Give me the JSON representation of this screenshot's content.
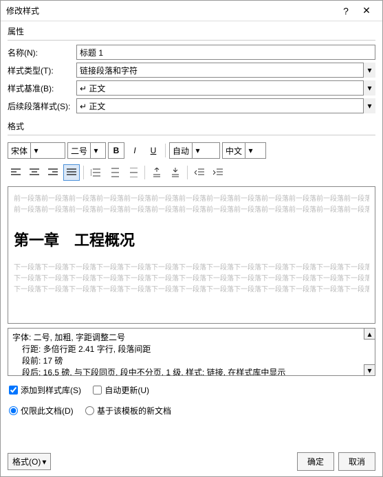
{
  "dialog": {
    "title": "修改样式"
  },
  "sections": {
    "properties": "属性",
    "format": "格式"
  },
  "labels": {
    "name": "名称(N):",
    "style_type": "样式类型(T):",
    "style_base": "样式基准(B):",
    "next_style": "后续段落样式(S):"
  },
  "values": {
    "name": "标题 1",
    "style_type": "链接段落和字符",
    "style_base": "↵ 正文",
    "next_style": "↵ 正文",
    "font_family": "宋体",
    "font_size": "二号",
    "auto_color": "自动",
    "lang": "中文"
  },
  "preview": {
    "gray_before": "前一段落前一段落前一段落前一段落前一段落前一段落前一段落前一段落前一段落前一段落前一段落前一段落前一段落前一段落前一段落",
    "heading": "第一章　工程概况",
    "gray_after": "下一段落下一段落下一段落下一段落下一段落下一段落下一段落下一段落下一段落下一段落下一段落下一段落下一段落下一段落下一段落下一段落下一段落下一段落下一段落下一段落下一段落下一段落下一段落下一段落下一段落下一段落"
  },
  "description": {
    "line1": "字体: 二号, 加粗, 字距调整二号",
    "line2": "行距: 多倍行距 2.41 字行, 段落间距",
    "line3": "段前: 17 磅",
    "line4": "段后: 16.5 磅, 与下段同页, 段中不分页, 1 级, 样式: 链接, 在样式库中显示"
  },
  "checks": {
    "add_to_gallery": "添加到样式库(S)",
    "auto_update": "自动更新(U)",
    "this_doc": "仅限此文档(D)",
    "template_based": "基于该模板的新文档"
  },
  "buttons": {
    "format": "格式(O)",
    "ok": "确定",
    "cancel": "取消"
  }
}
